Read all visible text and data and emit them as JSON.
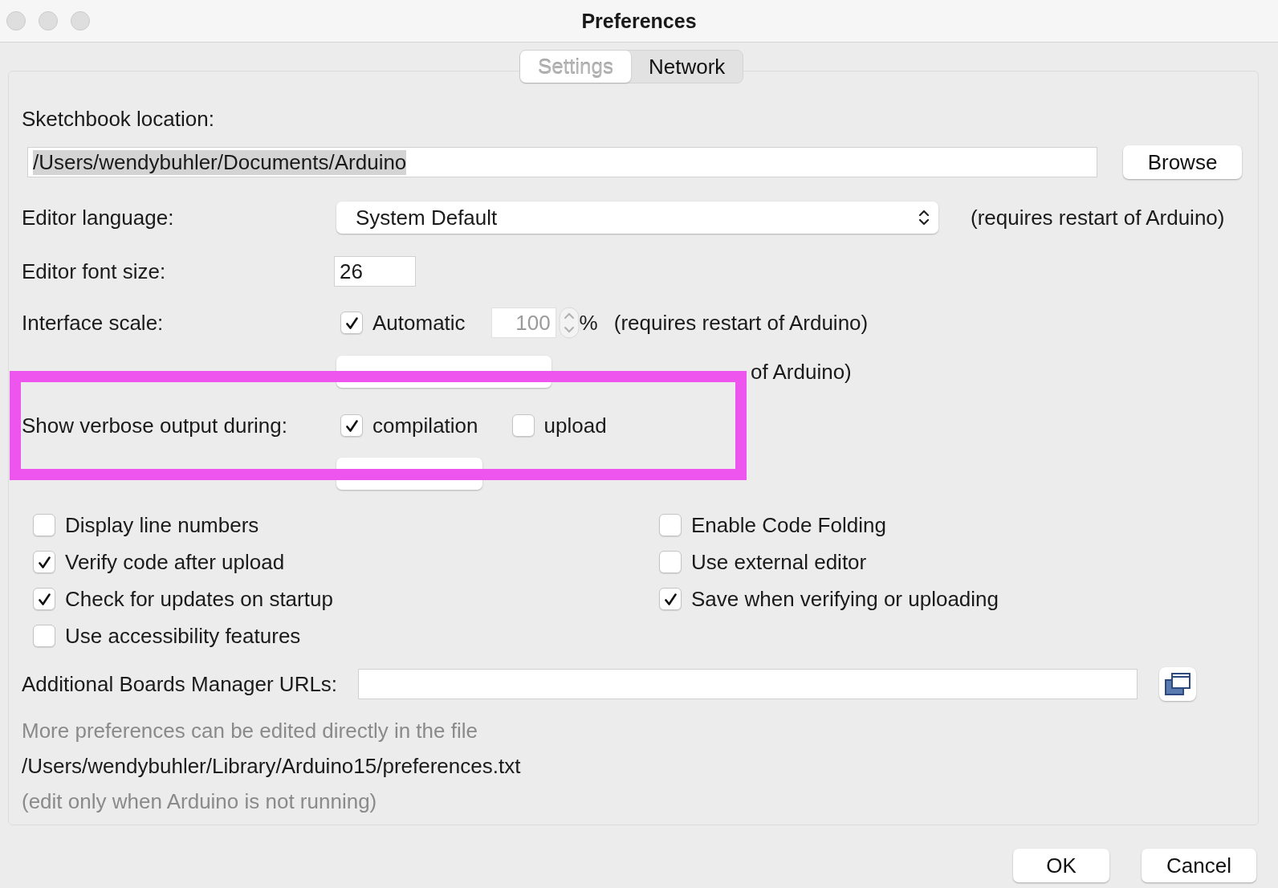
{
  "window": {
    "title": "Preferences"
  },
  "tabs": [
    {
      "label": "Settings",
      "selected": true
    },
    {
      "label": "Network",
      "selected": false
    }
  ],
  "sketchbook": {
    "label": "Sketchbook location:",
    "value": "/Users/wendybuhler/Documents/Arduino",
    "value_highlighted": true,
    "button": "Browse"
  },
  "editor_language": {
    "label": "Editor language:",
    "value": "System Default",
    "note": "(requires restart of Arduino)"
  },
  "font_size": {
    "label": "Editor font size:",
    "value": "26"
  },
  "interface_scale": {
    "label": "Interface scale:",
    "automatic": {
      "label": "Automatic",
      "checked": true
    },
    "value": "100",
    "disabled": true,
    "unit": "%",
    "note": "(requires restart of Arduino)"
  },
  "theme": {
    "note": "of Arduino)"
  },
  "verbose": {
    "label": "Show verbose output during:",
    "options": [
      {
        "label": "compilation",
        "checked": true
      },
      {
        "label": "upload",
        "checked": false
      }
    ]
  },
  "options_column_1": [
    {
      "label": "Display line numbers",
      "checked": false
    },
    {
      "label": "Verify code after upload",
      "checked": true
    },
    {
      "label": "Check for updates on startup",
      "checked": true
    },
    {
      "label": "Use accessibility features",
      "checked": false
    }
  ],
  "options_column_2": [
    {
      "label": "Enable Code Folding",
      "checked": false
    },
    {
      "label": "Use external editor",
      "checked": false
    },
    {
      "label": "Save when verifying or uploading",
      "checked": true
    }
  ],
  "boards_urls": {
    "label": "Additional Boards Manager URLs:"
  },
  "footer": [
    {
      "kind": "hint",
      "text": "More preferences can be edited directly in the file"
    },
    {
      "kind": "path",
      "text": "/Users/wendybuhler/Library/Arduino15/preferences.txt"
    },
    {
      "kind": "hint",
      "text": "(edit only when Arduino is not running)"
    }
  ],
  "buttons": [
    {
      "label": "OK"
    },
    {
      "label": "Cancel"
    }
  ],
  "annotation": {
    "kind": "highlight"
  }
}
